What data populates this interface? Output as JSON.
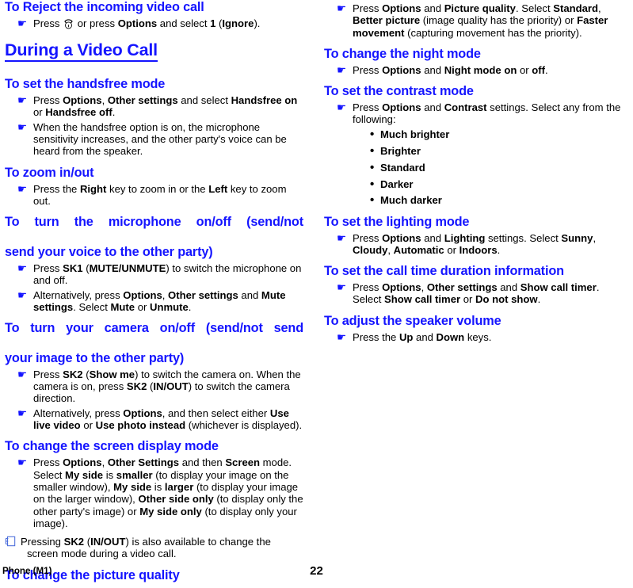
{
  "document": {
    "footer_left": "Phone (M1)",
    "page_number": "22",
    "accent_color": "#1414ff",
    "text_color": "#000000"
  },
  "icons": {
    "hand_bullet": "☛",
    "dot_bullet": "•",
    "end_call_icon": "end-call-icon",
    "note_icon": "note-icon"
  },
  "left_column": {
    "section_reject": {
      "heading": "To Reject the incoming video call",
      "bullet1": {
        "pre": "Press ",
        "mid": " or press ",
        "b1": "Options",
        "mid2": " and select ",
        "b2": "1",
        "mid3": " (",
        "b3": "Ignore",
        "end": ")."
      }
    },
    "chapter_heading": "During a Video Call",
    "section_handsfree": {
      "heading": "To set the handsfree mode",
      "bullet1": {
        "t1": "Press ",
        "b1": "Options",
        "t2": ", ",
        "b2": "Other settings",
        "t3": " and select ",
        "b3": "Handsfree on",
        "t4": " or ",
        "b4": "Handsfree off",
        "t5": "."
      },
      "bullet2": "When the handsfree option is on, the microphone sensitivity increases, and the other party's voice can be heard from the speaker."
    },
    "section_zoom": {
      "heading": "To zoom in/out",
      "bullet1": {
        "t1": "Press the ",
        "b1": "Right",
        "t2": " key to zoom in or the ",
        "b2": "Left",
        "t3": " key to zoom out."
      }
    },
    "section_mic": {
      "heading_line1": "To turn the microphone on/off (send/not",
      "heading_line2": "send your voice to the other party)",
      "bullet1": {
        "t1": "Press ",
        "b1": "SK1",
        "t2": " (",
        "b2": "MUTE/UNMUTE",
        "t3": ") to switch the microphone on and off."
      },
      "bullet2": {
        "t1": "Alternatively, press ",
        "b1": "Options",
        "t2": ", ",
        "b2": "Other settings",
        "t3": " and ",
        "b3": "Mute settings",
        "t4": ". Select ",
        "b4": "Mute",
        "t5": " or ",
        "b5": "Unmute",
        "t6": "."
      }
    },
    "section_camera": {
      "heading_line1": "To turn your camera on/off (send/not send",
      "heading_line2": "your image to the other party)",
      "bullet1": {
        "t1": "Press ",
        "b1": "SK2",
        "t2": " (",
        "b2": "Show me",
        "t3": ") to switch the camera on. When the camera is on, press ",
        "b3": "SK2",
        "t4": " (",
        "b4": "IN/OUT",
        "t5": ") to switch the camera direction."
      },
      "bullet2": {
        "t1": "Alternatively, press ",
        "b1": "Options",
        "t2": ", and then select either ",
        "b2": "Use live video",
        "t3": " or ",
        "b3": "Use photo instead",
        "t4": " (whichever is displayed)."
      }
    },
    "section_screen": {
      "heading": "To change the screen display mode",
      "bullet1": {
        "t1": "Press ",
        "b1": "Options",
        "t2": ", ",
        "b2": "Other Settings",
        "t3": " and then ",
        "b3": "Screen",
        "t4": " mode. Select ",
        "b4": "My side",
        "t5": " is ",
        "b5": "smaller",
        "t6": " (to display your image on the smaller window), ",
        "b6": "My side",
        "t7": " is ",
        "b7": "larger",
        "t8": " (to display your image on the larger window), ",
        "b8": "Other side only",
        "t9": " (to display only the other party's image) or ",
        "b9": "My side only",
        "t10": " (to display only your image)."
      },
      "note": {
        "t1": "Pressing ",
        "b1": "SK2",
        "t2": " (",
        "b2": "IN/OUT",
        "t3": ") is also available to change the",
        "line2": "screen mode during a video call."
      }
    },
    "section_picture_quality": {
      "heading": "To change the picture quality"
    }
  },
  "right_column": {
    "section_picture_quality_cont": {
      "bullet1": {
        "t1": "Press ",
        "b1": "Options",
        "t2": " and ",
        "b2": "Picture quality",
        "t3": ". Select ",
        "b3": "Standard",
        "t4": ", ",
        "b4": "Better picture",
        "t5": " (image quality has the priority) or ",
        "b5": "Faster movement",
        "t6": " (capturing movement has the priority)."
      }
    },
    "section_night": {
      "heading": "To change the night mode",
      "bullet1": {
        "t1": "Press ",
        "b1": "Options",
        "t2": " and ",
        "b2": "Night mode on",
        "t3": " or ",
        "b3": "off",
        "t4": "."
      }
    },
    "section_contrast": {
      "heading": "To set the contrast mode",
      "bullet1": {
        "t1": "Press ",
        "b1": "Options",
        "t2": " and ",
        "b2": "Contrast",
        "t3": " settings. Select any from the following:"
      },
      "options": [
        "Much brighter",
        "Brighter",
        "Standard",
        "Darker",
        "Much darker"
      ]
    },
    "section_lighting": {
      "heading": "To set the lighting mode",
      "bullet1": {
        "t1": "Press ",
        "b1": "Options",
        "t2": " and ",
        "b2": "Lighting",
        "t3": " settings. Select ",
        "b3": "Sunny",
        "t4": ", ",
        "b4": "Cloudy",
        "t5": ", ",
        "b5": "Automatic",
        "t6": " or ",
        "b6": "Indoors",
        "t7": "."
      }
    },
    "section_calltime": {
      "heading": "To set the call time duration information",
      "bullet1": {
        "t1": "Press ",
        "b1": "Options",
        "t2": ", ",
        "b2": "Other settings",
        "t3": " and ",
        "b3": "Show call timer",
        "t4": ". Select ",
        "b4": "Show call timer",
        "t5": " or ",
        "b5": "Do not show",
        "t6": "."
      }
    },
    "section_speaker": {
      "heading": "To adjust the speaker volume",
      "bullet1": {
        "t1": "Press the ",
        "b1": "Up",
        "t2": " and ",
        "b2": "Down",
        "t3": " keys."
      }
    }
  }
}
